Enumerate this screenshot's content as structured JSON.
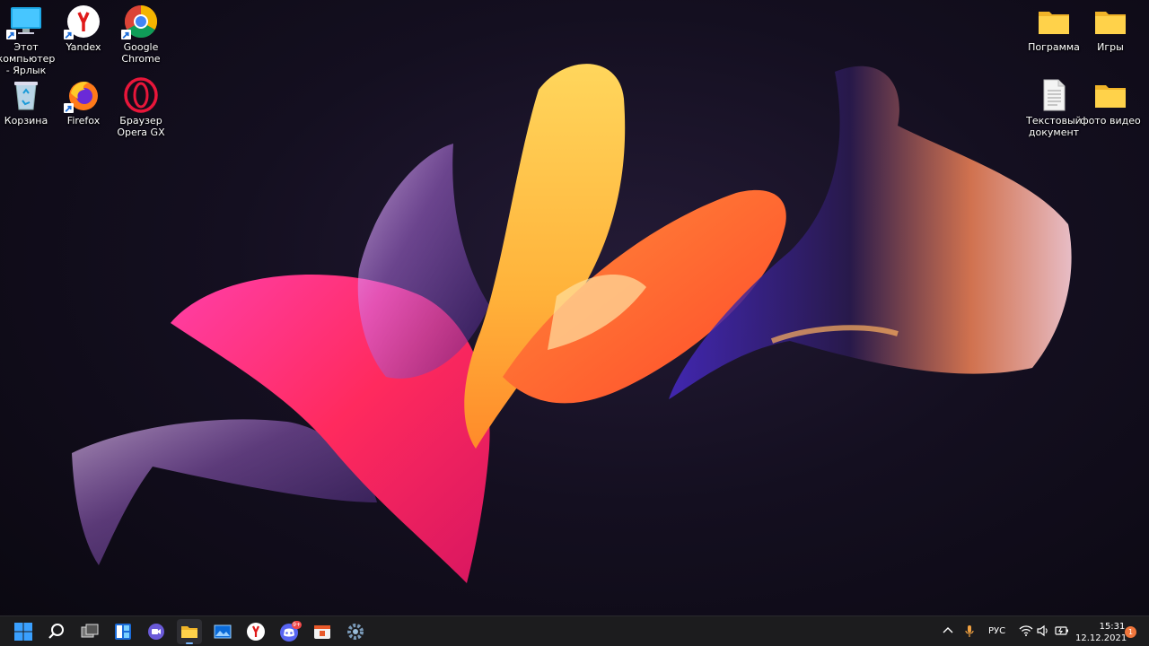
{
  "desktop_icons": [
    {
      "label": "Этот компьютер - Ярлык",
      "icon": "this-pc-icon"
    },
    {
      "label": "Yandex",
      "icon": "yandex-browser-icon"
    },
    {
      "label": "Google Chrome",
      "icon": "chrome-icon"
    },
    {
      "label": "Корзина",
      "icon": "recycle-bin-icon"
    },
    {
      "label": "Firefox",
      "icon": "firefox-icon"
    },
    {
      "label": "Браузер Opera GX",
      "icon": "opera-gx-icon"
    },
    {
      "label": "Пограмма",
      "icon": "folder-icon"
    },
    {
      "label": "Игры",
      "icon": "folder-icon"
    },
    {
      "label": "Текстовый документ",
      "icon": "text-document-icon"
    },
    {
      "label": "фото видео",
      "icon": "folder-icon"
    }
  ],
  "taskbar": {
    "apps": [
      "start-icon",
      "search-icon",
      "task-view-icon",
      "widgets-icon",
      "teams-chat-icon",
      "file-explorer-icon",
      "photos-icon",
      "yandex-browser-icon",
      "discord-icon",
      "office-icon",
      "settings-icon"
    ],
    "discord_badge": "9+",
    "accent": "#7ab8ff"
  },
  "tray": {
    "language": "РУС",
    "time": "15:31",
    "date": "12.12.2021",
    "notifications": "1"
  }
}
